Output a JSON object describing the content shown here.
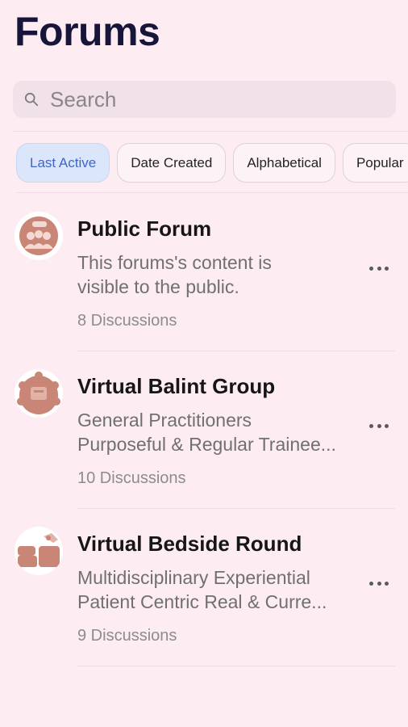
{
  "header": {
    "title": "Forums"
  },
  "search": {
    "placeholder": "Search",
    "icon": "search-icon"
  },
  "filters": [
    {
      "label": "Last Active",
      "active": true
    },
    {
      "label": "Date Created",
      "active": false
    },
    {
      "label": "Alphabetical",
      "active": false
    },
    {
      "label": "Popular",
      "active": false
    }
  ],
  "forums": [
    {
      "title": "Public Forum",
      "desc_line1": "This forums's content is",
      "desc_line2": "visible to the public.",
      "count": "8 Discussions",
      "avatar_icon": "people-group-icon"
    },
    {
      "title": "Virtual Balint Group",
      "desc_line1": "General Practitioners",
      "desc_line2": "Purposeful & Regular Trainee...",
      "count": "10 Discussions",
      "avatar_icon": "meeting-table-icon"
    },
    {
      "title": "Virtual Bedside Round",
      "desc_line1": "Multidisciplinary Experiential",
      "desc_line2": "Patient Centric Real & Curre...",
      "count": "9 Discussions",
      "avatar_icon": "hospital-bed-icon"
    }
  ],
  "colors": {
    "background": "#fdedf3",
    "accent": "#3e67c4",
    "avatar": "#c98576",
    "title": "#17163a"
  }
}
